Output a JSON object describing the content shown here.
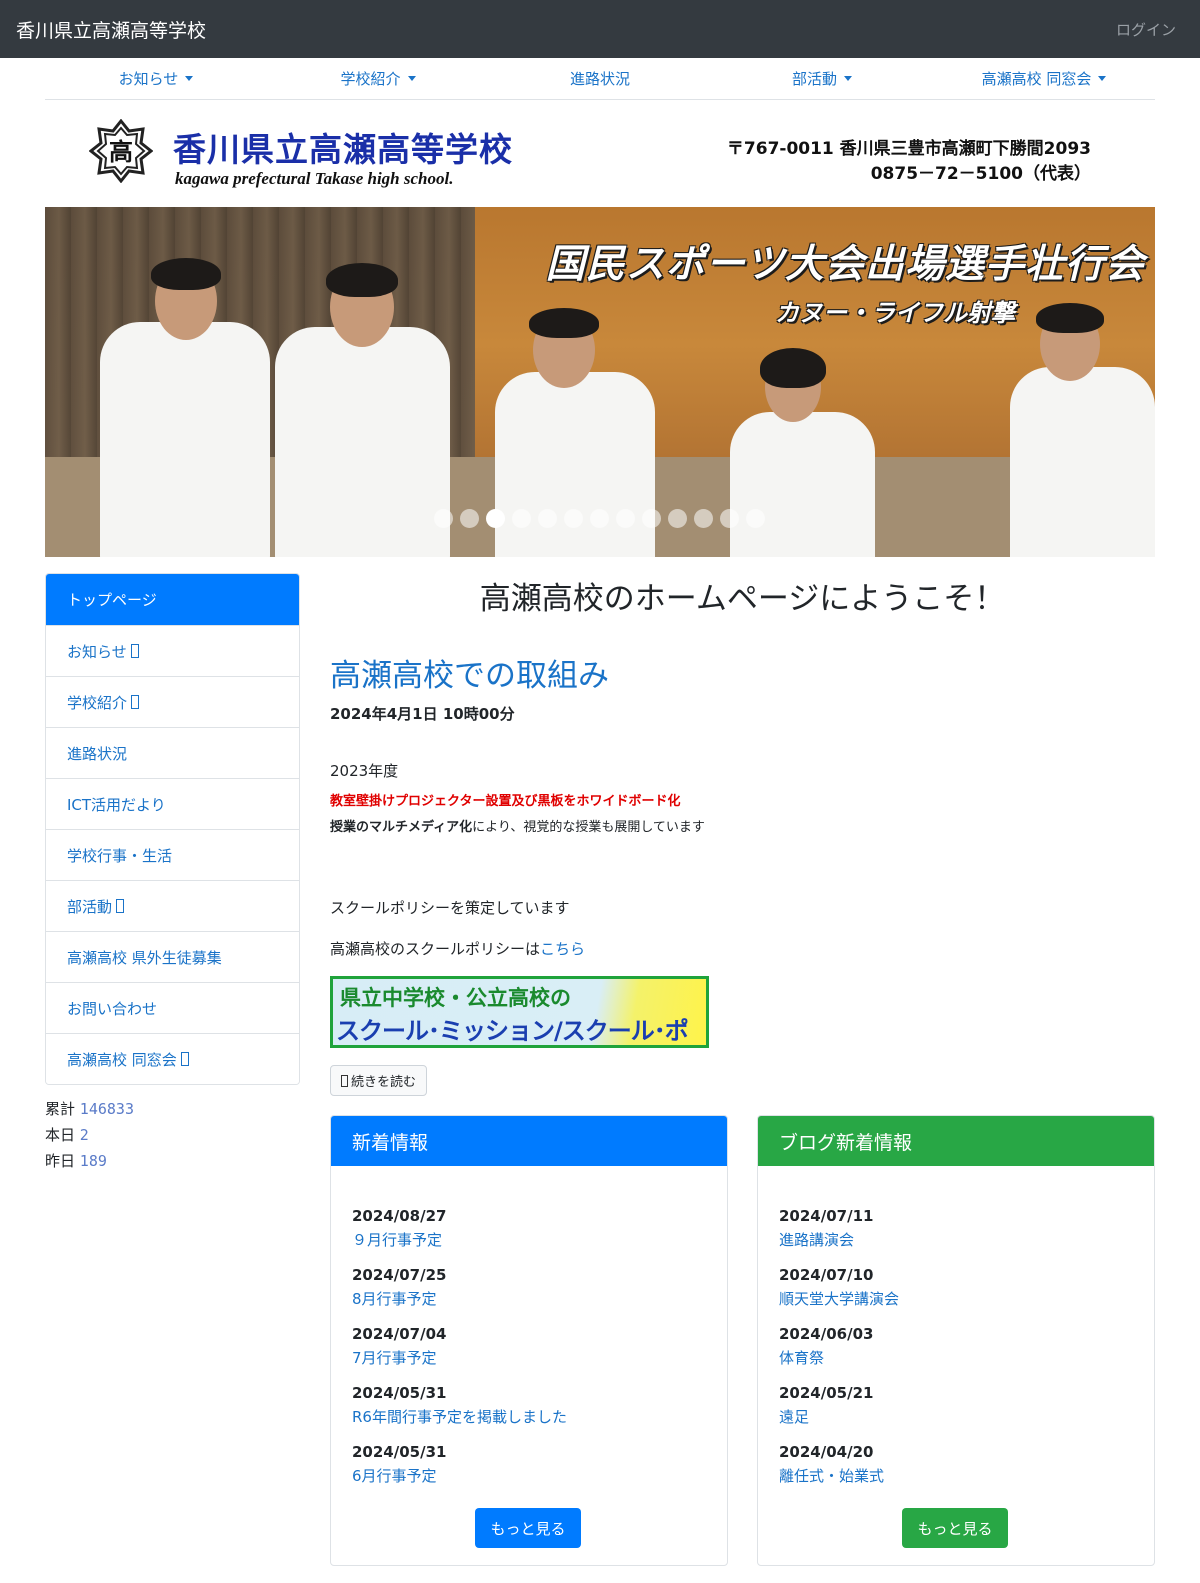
{
  "header": {
    "site_title": "香川県立高瀬高等学校",
    "login": "ログイン"
  },
  "nav": [
    {
      "label": "お知らせ",
      "dropdown": true
    },
    {
      "label": "学校紹介",
      "dropdown": true
    },
    {
      "label": "進路状況",
      "dropdown": false
    },
    {
      "label": "部活動",
      "dropdown": true
    },
    {
      "label": "高瀬高校 同窓会",
      "dropdown": true
    }
  ],
  "banner": {
    "emblem_char": "高",
    "school_name_jp": "香川県立高瀬高等学校",
    "school_name_en": "kagawa prefectural Takase high school.",
    "address": "〒767-0011 香川県三豊市高瀬町下勝間2093",
    "phone": "0875－72－5100（代表）"
  },
  "hero": {
    "title": "国民スポーツ大会出場選手壮行会",
    "subtitle": "カヌー・ライフル射撃",
    "active_slide": 3,
    "slide_count": 13
  },
  "sidebar": {
    "items": [
      {
        "label": "トップページ",
        "active": true,
        "box": false
      },
      {
        "label": "お知らせ",
        "active": false,
        "box": true
      },
      {
        "label": "学校紹介",
        "active": false,
        "box": true
      },
      {
        "label": "進路状況",
        "active": false,
        "box": false
      },
      {
        "label": "ICT活用だより",
        "active": false,
        "box": false
      },
      {
        "label": "学校行事・生活",
        "active": false,
        "box": false
      },
      {
        "label": "部活動",
        "active": false,
        "box": true
      },
      {
        "label": "高瀬高校 県外生徒募集",
        "active": false,
        "box": false
      },
      {
        "label": "お問い合わせ",
        "active": false,
        "box": false
      },
      {
        "label": "高瀬高校 同窓会",
        "active": false,
        "box": true
      }
    ]
  },
  "counter": {
    "total_label": "累計",
    "total": "146833",
    "today_label": "本日",
    "today": "2",
    "yesterday_label": "昨日",
    "yesterday": "189"
  },
  "main": {
    "welcome": "高瀬高校のホームページにようこそ！",
    "post": {
      "title": "高瀬高校での取組み",
      "date": "2024年4月1日 10時00分",
      "year": "2023年度",
      "red_text": "教室壁掛けプロジェクター設置及び黒板をホワイドボード化",
      "line_bold": "授業のマルチメディア化",
      "line_rest": "により、視覚的な授業も展開しています",
      "policy": "スクールポリシーを策定しています",
      "link_prefix": "高瀬高校のスクールポリシーは",
      "link_text": "こちら",
      "banner_line1": "県立中学校・公立高校の",
      "banner_line2": "スクール･ミッション/スクール･ポリシー",
      "read_more": "続きを読む"
    }
  },
  "news": {
    "title": "新着情報",
    "more": "もっと見る",
    "items": [
      {
        "date": "2024/08/27",
        "title": "９月行事予定"
      },
      {
        "date": "2024/07/25",
        "title": "8月行事予定"
      },
      {
        "date": "2024/07/04",
        "title": "7月行事予定"
      },
      {
        "date": "2024/05/31",
        "title": "R6年間行事予定を掲載しました"
      },
      {
        "date": "2024/05/31",
        "title": "6月行事予定"
      }
    ]
  },
  "blog": {
    "title": "ブログ新着情報",
    "more": "もっと見る",
    "items": [
      {
        "date": "2024/07/11",
        "title": "進路講演会"
      },
      {
        "date": "2024/07/10",
        "title": "順天堂大学講演会"
      },
      {
        "date": "2024/06/03",
        "title": "体育祭"
      },
      {
        "date": "2024/05/21",
        "title": "遠足"
      },
      {
        "date": "2024/04/20",
        "title": "離任式・始業式"
      }
    ]
  },
  "colors": {
    "primary": "#007bff",
    "success": "#28a745",
    "navbar": "#343a40",
    "link": "#1a73c8",
    "alert_red": "#e00000"
  }
}
